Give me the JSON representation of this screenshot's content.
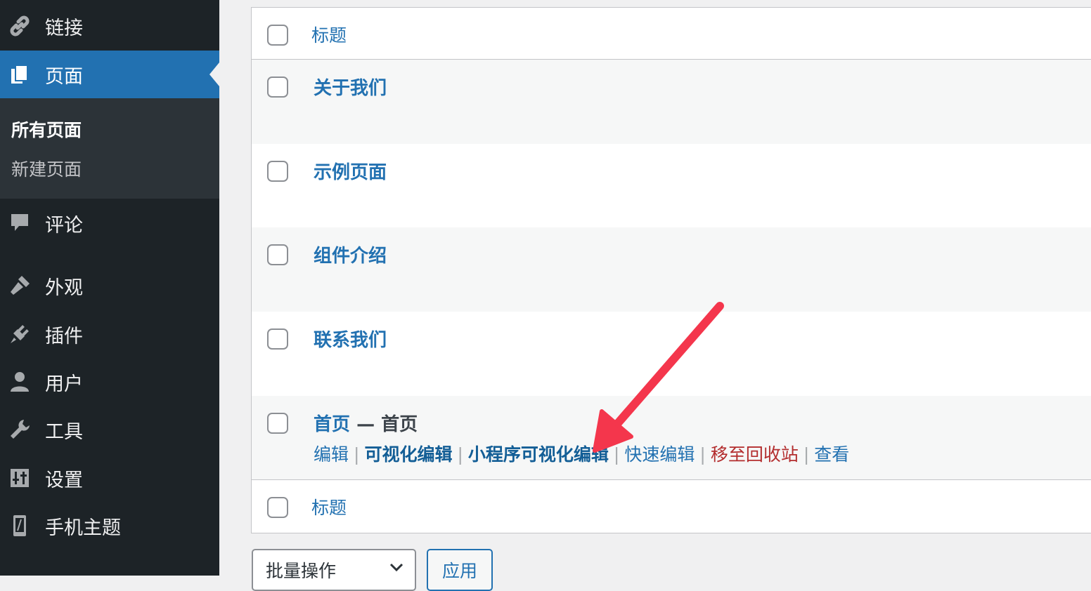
{
  "colors": {
    "sidebar_bg": "#1d2327",
    "sidebar_active": "#2271b1",
    "link": "#2271b1",
    "trash": "#b32d2e",
    "annotation_arrow": "#f4364c"
  },
  "sidebar": {
    "items": [
      {
        "label": "链接",
        "icon": "link-icon"
      },
      {
        "label": "页面",
        "icon": "pages-icon",
        "current": true
      },
      {
        "label": "评论",
        "icon": "comment-icon"
      },
      {
        "label": "外观",
        "icon": "paintbrush-icon"
      },
      {
        "label": "插件",
        "icon": "plugin-icon"
      },
      {
        "label": "用户",
        "icon": "user-icon"
      },
      {
        "label": "工具",
        "icon": "wrench-icon"
      },
      {
        "label": "设置",
        "icon": "settings-icon"
      },
      {
        "label": "手机主题",
        "icon": "phone-icon"
      }
    ],
    "submenu": [
      {
        "label": "所有页面",
        "active": true
      },
      {
        "label": "新建页面"
      }
    ]
  },
  "table": {
    "header_title": "标题",
    "footer_title": "标题",
    "rows": [
      {
        "title": "关于我们"
      },
      {
        "title": "示例页面"
      },
      {
        "title": "组件介绍"
      },
      {
        "title": "联系我们"
      },
      {
        "title": "首页",
        "state": " — 首页"
      }
    ],
    "row_actions": {
      "edit": "编辑",
      "visual_edit": "可视化编辑",
      "miniapp_visual_edit": "小程序可视化编辑",
      "quick_edit": "快速编辑",
      "trash": "移至回收站",
      "view": "查看",
      "separator": "|"
    }
  },
  "bulk_actions": {
    "selected": "批量操作",
    "apply": "应用"
  }
}
